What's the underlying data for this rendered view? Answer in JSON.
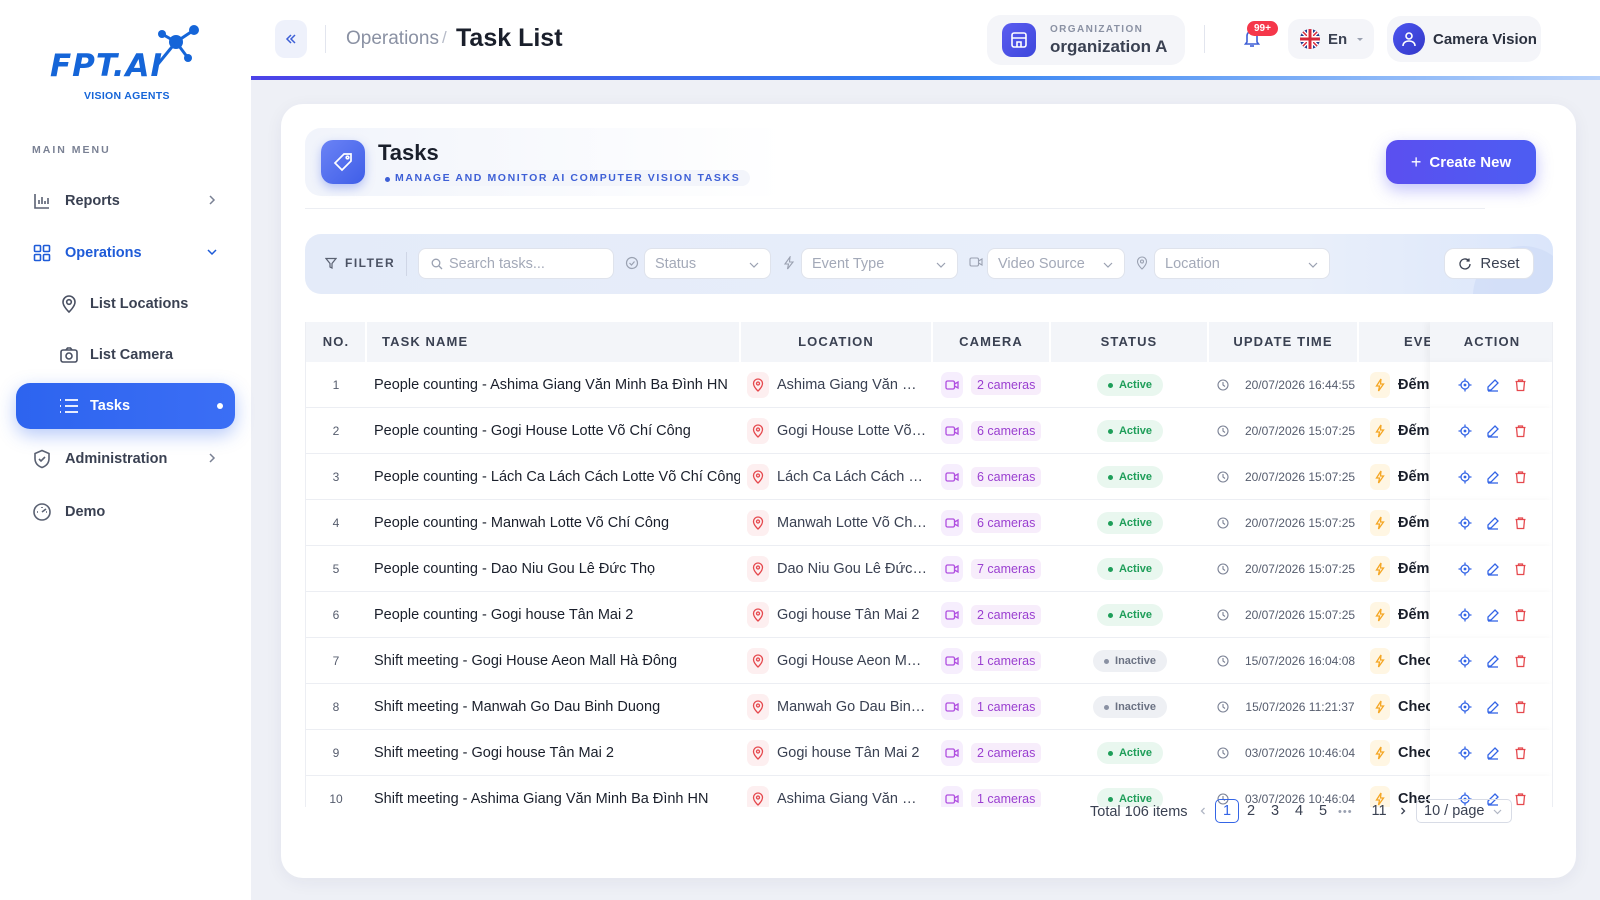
{
  "brand": {
    "logo_text": "FPT.AI",
    "tagline": "VISION AGENTS"
  },
  "sidebar": {
    "menu_label": "MAIN MENU",
    "items": [
      {
        "label": "Reports",
        "icon": "bar-chart-icon"
      },
      {
        "label": "Operations",
        "icon": "grid-icon"
      },
      {
        "label": "List Locations",
        "icon": "map-pin-icon"
      },
      {
        "label": "List Camera",
        "icon": "camera-icon"
      },
      {
        "label": "Tasks",
        "icon": "list-icon"
      },
      {
        "label": "Administration",
        "icon": "shield-icon"
      },
      {
        "label": "Demo",
        "icon": "gauge-icon"
      }
    ]
  },
  "header": {
    "breadcrumb_parent": "Operations",
    "breadcrumb_sep": "/",
    "title": "Task List",
    "org_label": "ORGANIZATION",
    "org_name": "organization A",
    "notif_badge": "99+",
    "language": "En",
    "user_name": "Camera Vision"
  },
  "page": {
    "title": "Tasks",
    "subtitle": "MANAGE AND MONITOR AI COMPUTER VISION TASKS",
    "create_button": "Create New"
  },
  "filter": {
    "label": "FILTER",
    "search_placeholder": "Search tasks...",
    "status_placeholder": "Status",
    "event_type_placeholder": "Event Type",
    "video_source_placeholder": "Video Source",
    "location_placeholder": "Location",
    "reset_label": "Reset"
  },
  "table": {
    "columns": [
      "NO.",
      "TASK NAME",
      "LOCATION",
      "CAMERA",
      "STATUS",
      "UPDATE TIME",
      "EVE",
      "ACTION"
    ],
    "rows": [
      {
        "no": "1",
        "name": "People counting - Ashima Giang Văn Minh Ba Đình HN",
        "location": "Ashima Giang Văn Minh Ba Đình HN",
        "camera": "2 cameras",
        "status": "Active",
        "status_kind": "active",
        "time": "20/07/2026 16:44:55",
        "event": "Đếm người"
      },
      {
        "no": "2",
        "name": "People counting - Gogi House Lotte Võ Chí Công",
        "location": "Gogi House Lotte Võ Chí Công",
        "camera": "6 cameras",
        "status": "Active",
        "status_kind": "active",
        "time": "20/07/2026 15:07:25",
        "event": "Đếm người"
      },
      {
        "no": "3",
        "name": "People counting - Lách Ca Lách Cách Lotte Võ Chí Công",
        "location": "Lách Ca Lách Cách Lotte Võ Chí Công",
        "camera": "6 cameras",
        "status": "Active",
        "status_kind": "active",
        "time": "20/07/2026 15:07:25",
        "event": "Đếm người"
      },
      {
        "no": "4",
        "name": "People counting - Manwah Lotte Võ Chí Công",
        "location": "Manwah Lotte Võ Chí Công",
        "camera": "6 cameras",
        "status": "Active",
        "status_kind": "active",
        "time": "20/07/2026 15:07:25",
        "event": "Đếm người"
      },
      {
        "no": "5",
        "name": "People counting - Dao Niu Gou Lê Đức Thọ",
        "location": "Dao Niu Gou Lê Đức Thọ",
        "camera": "7 cameras",
        "status": "Active",
        "status_kind": "active",
        "time": "20/07/2026 15:07:25",
        "event": "Đếm người"
      },
      {
        "no": "6",
        "name": "People counting - Gogi house Tân Mai 2",
        "location": "Gogi house Tân Mai 2",
        "camera": "2 cameras",
        "status": "Active",
        "status_kind": "active",
        "time": "20/07/2026 15:07:25",
        "event": "Đếm người"
      },
      {
        "no": "7",
        "name": "Shift meeting - Gogi House Aeon Mall Hà Đông",
        "location": "Gogi House Aeon Mall Hà Đông",
        "camera": "1 cameras",
        "status": "Inactive",
        "status_kind": "inactive",
        "time": "15/07/2026 16:04:08",
        "event": "Check"
      },
      {
        "no": "8",
        "name": "Shift meeting - Manwah Go Dau Binh Duong",
        "location": "Manwah Go Dau Binh Duong",
        "camera": "1 cameras",
        "status": "Inactive",
        "status_kind": "inactive",
        "time": "15/07/2026 11:21:37",
        "event": "Check"
      },
      {
        "no": "9",
        "name": "Shift meeting - Gogi house Tân Mai 2",
        "location": "Gogi house Tân Mai 2",
        "camera": "2 cameras",
        "status": "Active",
        "status_kind": "active",
        "time": "03/07/2026 10:46:04",
        "event": "Check"
      },
      {
        "no": "10",
        "name": "Shift meeting - Ashima Giang Văn Minh Ba Đình HN",
        "location": "Ashima Giang Văn Minh Ba Đình HN",
        "camera": "1 cameras",
        "status": "Active",
        "status_kind": "active",
        "time": "03/07/2026 10:46:04",
        "event": "Check"
      }
    ]
  },
  "pagination": {
    "total": "Total 106 items",
    "pages": [
      "1",
      "2",
      "3",
      "4",
      "5",
      "11"
    ],
    "current": "1",
    "ellipsis": "•••",
    "page_size": "10 / page"
  },
  "colors": {
    "primary": "#2d64ef",
    "accent": "#5b4ff0",
    "active_green": "#1e9e59",
    "camera_purple": "#9a3fd0",
    "location_red": "#e5484d",
    "event_orange": "#f5a623"
  }
}
